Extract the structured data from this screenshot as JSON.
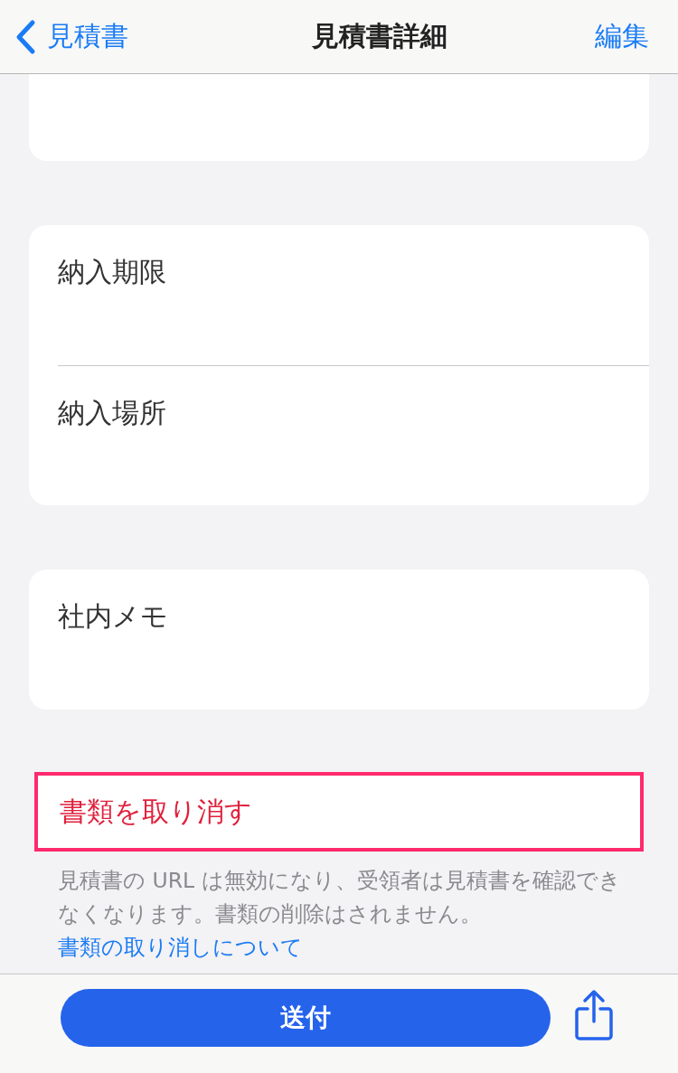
{
  "nav": {
    "back_label": "見積書",
    "title": "見積書詳細",
    "action": "編集"
  },
  "sections": [
    {
      "kind": "cut"
    },
    {
      "kind": "card",
      "rows": [
        {
          "label": "納入期限"
        },
        {
          "label": "納入場所"
        }
      ]
    },
    {
      "kind": "card",
      "rows": [
        {
          "label": "社内メモ"
        }
      ]
    }
  ],
  "cancel": {
    "label": "書類を取り消す",
    "highlighted": true
  },
  "note": {
    "text": "見積書の URL は無効になり、受領者は見積書を確認できなくなります。書類の削除はされません。",
    "link": "書類の取り消しについて"
  },
  "bottom_bar": {
    "send_label": "送付"
  }
}
